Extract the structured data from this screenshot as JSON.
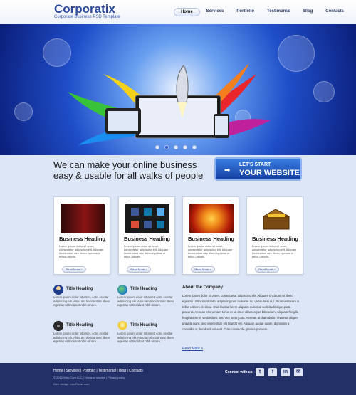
{
  "brand": {
    "logo": "Corporatix",
    "tagline": "Corporate Business PSD Template"
  },
  "nav": [
    "Home",
    "Services",
    "Portfolio",
    "Testimonial",
    "Blog",
    "Contacts"
  ],
  "promo": {
    "line1": "We can make your online business",
    "line2": "easy & usable for all walks of people"
  },
  "cta": {
    "line1": "LET'S START",
    "line2": "YOUR WEBSITE"
  },
  "cards": [
    {
      "title": "Business Heading",
      "text": "Lorem ipsum dolor sit amet, consectetur adipiscing elit. Aliquam tincidunt mi nec libero egestas ut tellus ultrices.",
      "more": "Read More >"
    },
    {
      "title": "Business Heading",
      "text": "Lorem ipsum dolor sit amet, consectetur adipiscing elit. Aliquam tincidunt mi nec libero egestas ut tellus ultrices.",
      "more": "Read More >"
    },
    {
      "title": "Business Heading",
      "text": "Lorem ipsum dolor sit amet, consectetur adipiscing elit. Aliquam tincidunt mi nec libero egestas ut tellus ultrices.",
      "more": "Read More >"
    },
    {
      "title": "Business Heading",
      "text": "Lorem ipsum dolor sit amet, consectetur adipiscing elit. Aliquam tincidunt mi nec libero egestas ut tellus ultrices.",
      "more": "Read More >"
    }
  ],
  "features": [
    {
      "title": "Title Heading",
      "text": "Lorem ipsum dolor sit amet, cons ectetur adipiscing elit. Aliqu am tincidunt mi libero egestas ut tincidunt nibh ornare."
    },
    {
      "title": "Title Heading",
      "text": "Lorem ipsum dolor sit amet, cons ectetur adipiscing elit. Aliqu am tincidunt mi libero egestas ut tincidunt nibh ornare."
    },
    {
      "title": "Title Heading",
      "text": "Lorem ipsum dolor sit amet, cons ectetur adipiscing elit. Aliqu am tincidunt mi libero egestas ut tincidunt nibh ornare."
    },
    {
      "title": "Title Heading",
      "text": "Lorem ipsum dolor sit amet, cons ectetur adipiscing elit. Aliqu am tincidunt mi libero egestas ut tincidunt nibh ornare."
    }
  ],
  "about": {
    "title": "About the Company",
    "text": "Lorem ipsum dolor sit amet, consectetur adipiscing elit. Aliquam tincidunt mi libero egestas ut tincidunt ante, adipiscing nec molestie ac, vehicula in dui. Proin vel lorem in tellus ultrices eleifend. Duis lacinia lorem aliquam euismod sollicitudinsque porta placerat. Aenean elementum tortor et sit amet ullamcorper bibendum. Aliquam fringilla feugiat ante in vestibulum. Sed nec justo justo. Aenean at diam dolor. Vivamus aliquet gravida nunc, sed elementum elit blandit vel. Aliquam augue quam, dignissim a convallis ut, hendrerit vel erat. Cras commodo gravida posuere.",
    "more": "Read More >"
  },
  "footer": {
    "nav": "Home  |  Services  |  Portfolio  |  Testimonial  |  Blog  |  Contacts",
    "copyright": "© 2012 Web Corp LLC  |  Terms of service  |  Privacy policy",
    "design": "Web design: IconFinder.com",
    "connect": "Connect with us:"
  },
  "social": [
    "twitter-icon",
    "facebook-icon",
    "linkedin-icon",
    "email-icon"
  ],
  "colors": {
    "accent": "#2b57c4",
    "footer": "#223067",
    "page": "#dde6f6"
  }
}
